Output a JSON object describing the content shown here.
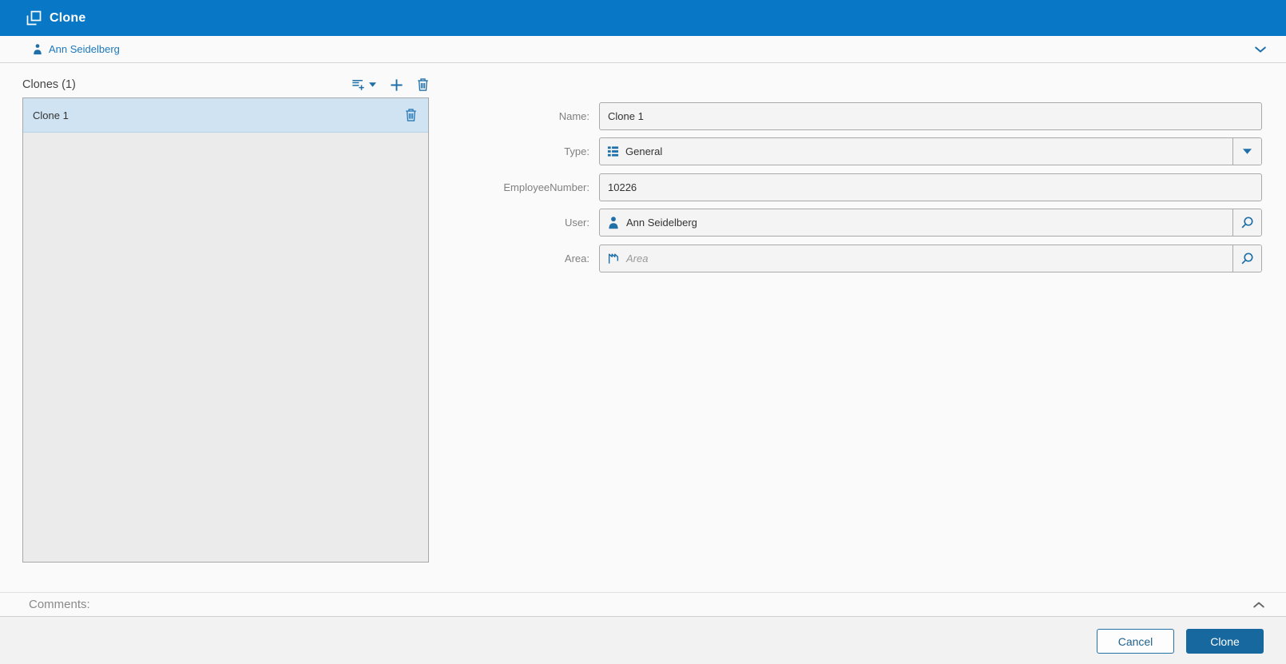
{
  "window": {
    "title": "Clone"
  },
  "subheader": {
    "user_name": "Ann Seidelberg"
  },
  "clones_panel": {
    "title": "Clones (1)",
    "items": [
      {
        "label": "Clone 1",
        "selected": true
      }
    ]
  },
  "form": {
    "fields": [
      {
        "label": "Name:",
        "value": "Clone 1",
        "type": "text"
      },
      {
        "label": "Type:",
        "value": "General",
        "type": "dropdown",
        "icon": "type-list-icon"
      },
      {
        "label": "EmployeeNumber:",
        "value": "10226",
        "type": "text"
      },
      {
        "label": "User:",
        "value": "Ann Seidelberg",
        "type": "lookup",
        "icon": "user-icon"
      },
      {
        "label": "Area:",
        "value": "",
        "placeholder": "Area",
        "type": "lookup",
        "icon": "area-icon"
      }
    ]
  },
  "comments": {
    "label": "Comments:"
  },
  "footer": {
    "cancel_label": "Cancel",
    "submit_label": "Clone"
  },
  "colors": {
    "header": "#0878c6",
    "accent": "#1f6fa8",
    "link": "#1b79bd",
    "primary_button": "#17689e",
    "selected_item": "#cfe3f3"
  }
}
